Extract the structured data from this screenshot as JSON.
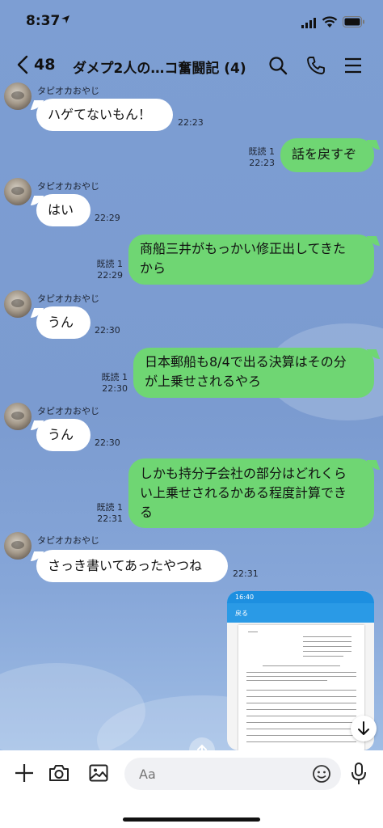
{
  "status": {
    "time": "8:37"
  },
  "header": {
    "unread": "48",
    "title": "ダメプ2人の…コ奮闘記 (4)"
  },
  "messages": [
    {
      "sender": "タピオカおやじ",
      "text": "ハゲてないもん！",
      "time": "22:23"
    },
    {
      "text": "話を戻すぞ",
      "read": "既読 1",
      "time": "22:23"
    },
    {
      "sender": "タピオカおやじ",
      "text": "はい",
      "time": "22:29"
    },
    {
      "text": "商船三井がもっかい修正出してきた\nから",
      "read": "既読 1",
      "time": "22:29"
    },
    {
      "sender": "タピオカおやじ",
      "text": "うん",
      "time": "22:30"
    },
    {
      "text": "日本郵船も8/4で出る決算はその分\nが上乗せされるやろ",
      "read": "既読 1",
      "time": "22:30"
    },
    {
      "sender": "タピオカおやじ",
      "text": "うん",
      "time": "22:30"
    },
    {
      "text": "しかも持分子会社の部分はどれくら\nい上乗せされるかある程度計算でき\nる",
      "read": "既読 1",
      "time": "22:31"
    },
    {
      "sender": "タピオカおやじ",
      "text": "さっき書いてあったやつね",
      "time": "22:31"
    }
  ],
  "image_message": {
    "status_time": "16:40",
    "nav_label": "戻る"
  },
  "input": {
    "placeholder": "Aa"
  },
  "colors": {
    "outgoing": "#6fd673",
    "incoming": "#ffffff",
    "background": "#7b9dd1"
  }
}
